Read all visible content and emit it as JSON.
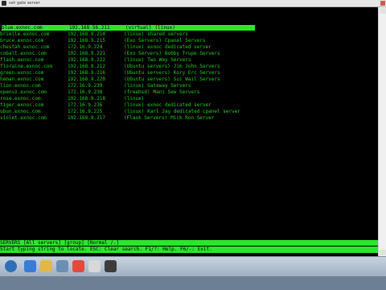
{
  "window": {
    "title": "ssh gate server"
  },
  "rows": [
    {
      "host": "blue.exnoc.com",
      "ip": "192.168.56.211",
      "group": "(virtual)",
      "desc": "(linux)",
      "selected": true
    },
    {
      "host": "brielle.exnoc.com",
      "ip": "192.168.9.214",
      "group": "(linux)",
      "desc": "shared servers"
    },
    {
      "host": "bruce.exnoc.com",
      "ip": "192.168.9.215",
      "group": "(Exo Servers)",
      "desc": "Cpanel Servers"
    },
    {
      "host": "chestah.exnoc.com",
      "ip": "172.16.9.224",
      "group": "(linux)",
      "desc": "exnoc dedicated server"
    },
    {
      "host": "cobalt.exnoc.com",
      "ip": "192.168.9.221",
      "group": "(Exo Servers)",
      "desc": "Bobby Trupe Servers"
    },
    {
      "host": "flash.exnoc.com",
      "ip": "192.168.9.222",
      "group": "(linux)",
      "desc": "Two Way Servers"
    },
    {
      "host": "floraine.exnoc.com",
      "ip": "192.168.9.212",
      "group": "(Ubuntu servers)",
      "desc": "Jim John Servers"
    },
    {
      "host": "green.exnoc.com",
      "ip": "192.168.9.216",
      "group": "(Ubuntu servers)",
      "desc": "Kory Erc Servers"
    },
    {
      "host": "heman.exnoc.com",
      "ip": "192.168.9.220",
      "group": "(Ubuntu servers)",
      "desc": "Sui Wail Servers"
    },
    {
      "host": "lion.exnoc.com",
      "ip": "172.16.9.239",
      "group": "(linux)",
      "desc": "Gateway Servers"
    },
    {
      "host": "openvz.exnoc.com",
      "ip": "172.16.9.238",
      "group": "(freebsd)",
      "desc": "Mani Sew Servers"
    },
    {
      "host": "rose.exnoc.com",
      "ip": "192.168.9.218",
      "group": "(linux)",
      "desc": ""
    },
    {
      "host": "tiger.exnoc.com",
      "ip": "172.16.9.236",
      "group": "(linux)",
      "desc": "exnoc dedicated server"
    },
    {
      "host": "ubun.exnoc.com",
      "ip": "172.16.9.225",
      "group": "(linux)",
      "desc": "Karl Jay dedicated cpanel server"
    },
    {
      "host": "violet.exnoc.com",
      "ip": "192.168.9.217",
      "group": "(Flask Servers)",
      "desc": "Mick Ron Server"
    }
  ],
  "status_line": "SERVERS [All servers] [group] [Normal /.]",
  "help_line": "Start typing string to locate. ESC: Clear search. F1/?: Help. F6/-: Exit.",
  "colors": {
    "terminal_bg": "#000000",
    "text_green": "#1ed21e",
    "highlight": "#2ce62c"
  }
}
